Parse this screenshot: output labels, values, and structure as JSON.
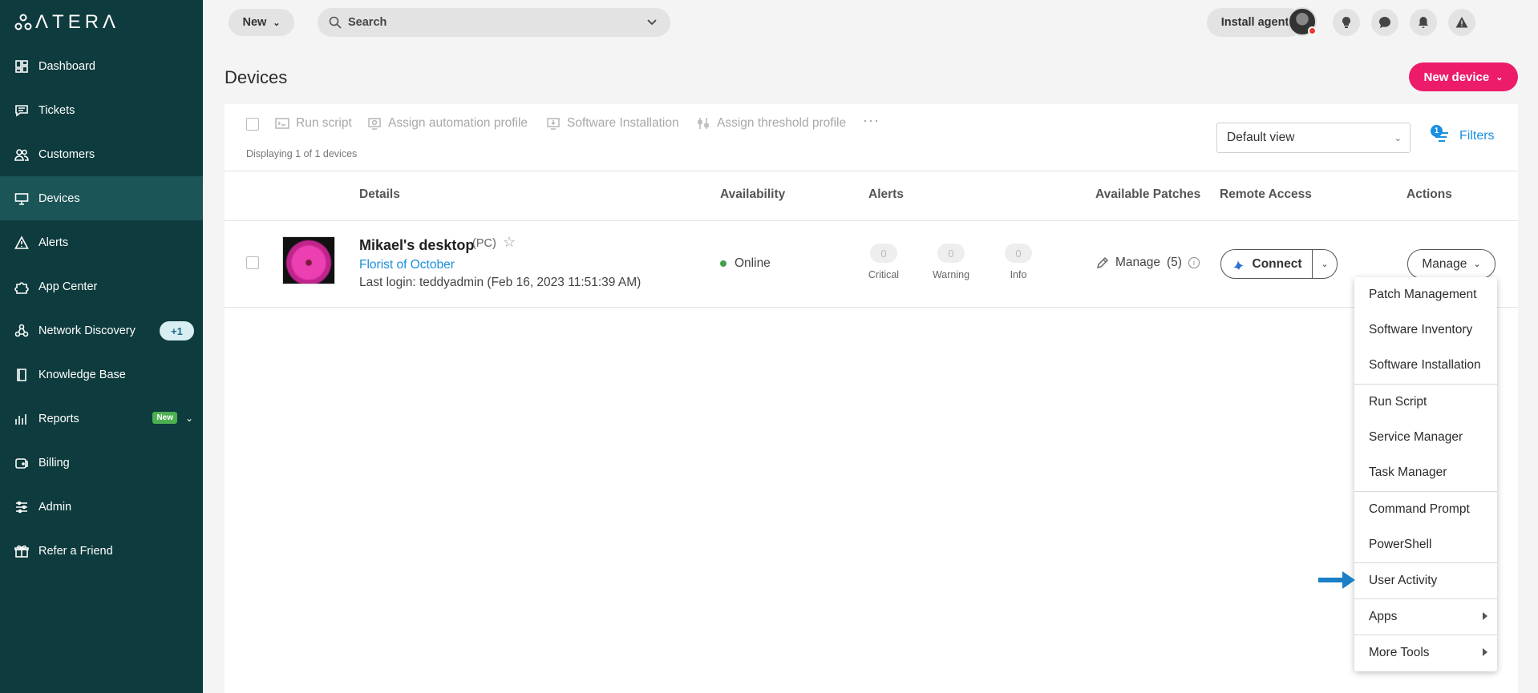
{
  "brand": {
    "logo_text": "ΛTERΛ"
  },
  "sidebar": {
    "items": [
      {
        "label": "Dashboard",
        "icon": "dashboard-icon"
      },
      {
        "label": "Tickets",
        "icon": "tickets-icon"
      },
      {
        "label": "Customers",
        "icon": "customers-icon"
      },
      {
        "label": "Devices",
        "icon": "devices-icon",
        "active": true
      },
      {
        "label": "Alerts",
        "icon": "alerts-icon"
      },
      {
        "label": "App Center",
        "icon": "app-center-icon"
      },
      {
        "label": "Network Discovery",
        "icon": "network-discovery-icon",
        "badge": "+1"
      },
      {
        "label": "Knowledge Base",
        "icon": "knowledge-base-icon"
      },
      {
        "label": "Reports",
        "icon": "reports-icon",
        "badge": "New"
      },
      {
        "label": "Billing",
        "icon": "billing-icon"
      },
      {
        "label": "Admin",
        "icon": "admin-icon"
      },
      {
        "label": "Refer a Friend",
        "icon": "gift-icon"
      }
    ]
  },
  "topbar": {
    "new_label": "New",
    "search_label": "Search",
    "install_agent_label": "Install agent"
  },
  "page": {
    "title": "Devices",
    "new_device_label": "New device"
  },
  "toolbar": {
    "run_script": "Run script",
    "assign_automation": "Assign automation profile",
    "software_installation": "Software Installation",
    "assign_threshold": "Assign threshold profile",
    "more": "···",
    "displaying": "Displaying 1 of 1 devices",
    "view": "Default view",
    "filters_label": "Filters",
    "filters_count": "1"
  },
  "table": {
    "columns": [
      "Details",
      "Availability",
      "Alerts",
      "Available Patches",
      "Remote Access",
      "Actions"
    ],
    "row": {
      "name": "Mikael's desktop",
      "type": "(PC)",
      "customer": "Florist of October",
      "last_login": "Last login: teddyadmin (Feb 16, 2023 11:51:39 AM)",
      "availability": "Online",
      "alerts": [
        {
          "count": "0",
          "label": "Critical"
        },
        {
          "count": "0",
          "label": "Warning"
        },
        {
          "count": "0",
          "label": "Info"
        }
      ],
      "patches_label": "Manage",
      "patches_count": "(5)",
      "connect_label": "Connect",
      "manage_label": "Manage"
    }
  },
  "dropdown": {
    "items": [
      "Patch Management",
      "Software Inventory",
      "Software Installation",
      "Run Script",
      "Service Manager",
      "Task Manager",
      "Command Prompt",
      "PowerShell",
      "User Activity",
      "Apps",
      "More Tools"
    ]
  },
  "colors": {
    "sidebar_bg": "#0e3b3d",
    "sidebar_active": "#1b5557",
    "accent_pink": "#ec1c6b",
    "link_blue": "#1a8fe0",
    "online_green": "#43a047",
    "pointer_arrow": "#1a7fc4"
  }
}
